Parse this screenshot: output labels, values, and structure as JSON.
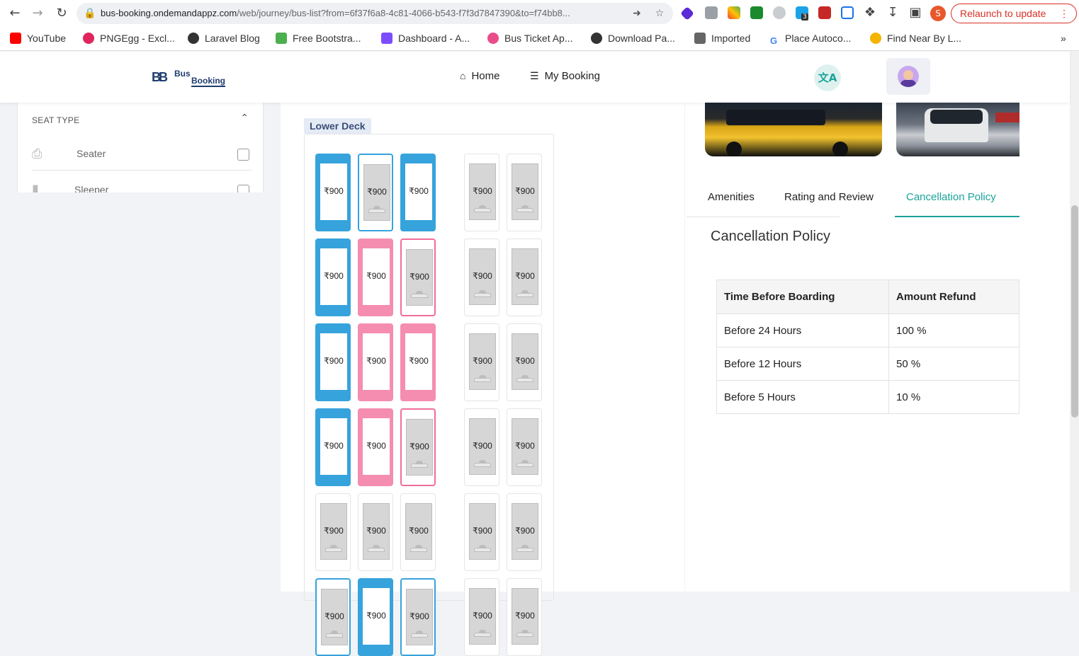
{
  "browser": {
    "url_host": "bus-booking.ondemandappz.com",
    "url_path": "/web/journey/bus-list?from=6f37f6a8-4c81-4066-b543-f7f3d7847390&to=f74bb8...",
    "relaunch_label": "Relaunch to update",
    "profile_initial": "S",
    "extension_badge": "3",
    "bookmarks": [
      {
        "label": "YouTube",
        "color": "#ff0000"
      },
      {
        "label": "PNGEgg - Excl...",
        "color": "#e0245e"
      },
      {
        "label": "Laravel Blog",
        "color": "#333333"
      },
      {
        "label": "Free Bootstra...",
        "color": "#4caf50"
      },
      {
        "label": "Dashboard - A...",
        "color": "#7c4dff"
      },
      {
        "label": "Bus Ticket Ap...",
        "color": "#ea4c89"
      },
      {
        "label": "Download Pa...",
        "color": "#333333"
      },
      {
        "label": "Imported",
        "color": "#666666"
      },
      {
        "label": "Place Autoco...",
        "color": "#4285f4"
      },
      {
        "label": "Find Near By L...",
        "color": "#f4b400"
      }
    ],
    "overflow": "»"
  },
  "header": {
    "logo_mark": "BB",
    "logo_word1": "Bus",
    "logo_word2": "Booking",
    "nav": [
      {
        "label": "Home",
        "icon": "home-icon"
      },
      {
        "label": "My Booking",
        "icon": "list-icon"
      }
    ],
    "translate_glyph": "文A"
  },
  "filters": {
    "section_title": "SEAT TYPE",
    "items": [
      {
        "label": "Seater",
        "checked": false
      },
      {
        "label": "Sleeper",
        "checked": false
      }
    ]
  },
  "deck": {
    "title": "Lower Deck",
    "currency": "₹",
    "rows": [
      [
        "blue",
        "blue-outline",
        "blue",
        "available",
        "available"
      ],
      [
        "blue",
        "pink",
        "pink-outline",
        "available",
        "available"
      ],
      [
        "blue",
        "pink",
        "pink",
        "available",
        "available"
      ],
      [
        "blue",
        "pink",
        "pink-outline",
        "available",
        "available"
      ],
      [
        "available",
        "available",
        "available",
        "available",
        "available"
      ],
      [
        "blue-outline",
        "blue",
        "blue-outline",
        "available",
        "available"
      ]
    ],
    "price": "900"
  },
  "details": {
    "tabs": [
      "Amenities",
      "Rating and Review",
      "Cancellation Policy"
    ],
    "active_tab": 2,
    "policy_title": "Cancellation Policy",
    "table": {
      "headers": [
        "Time Before Boarding",
        "Amount Refund"
      ],
      "rows": [
        [
          "Before 24 Hours",
          "100 %"
        ],
        [
          "Before 12 Hours",
          "50 %"
        ],
        [
          "Before 5 Hours",
          "10 %"
        ]
      ]
    }
  },
  "colors": {
    "accent": "#1aa39a",
    "booked_male": "#36a3dc",
    "booked_female": "#f58db0"
  }
}
